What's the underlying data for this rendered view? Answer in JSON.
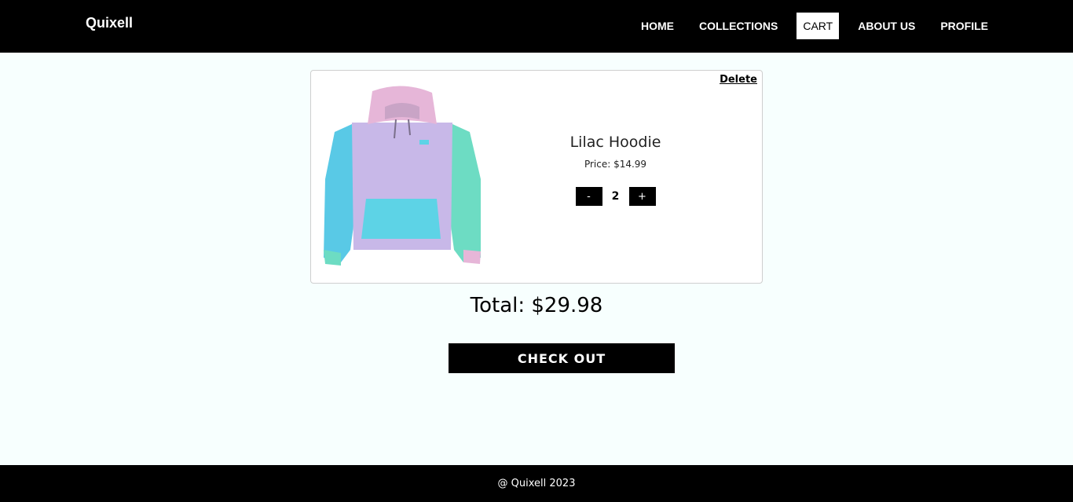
{
  "navbar": {
    "brand": "Quixell",
    "links": [
      {
        "label": "HOME"
      },
      {
        "label": "COLLECTIONS"
      },
      {
        "label": "CART"
      },
      {
        "label": "ABOUT US"
      },
      {
        "label": "PROFILE"
      }
    ],
    "active": "CART"
  },
  "cart": {
    "items": [
      {
        "delete_label": "Delete",
        "name": "Lilac Hoodie",
        "price_text": "Price: $14.99",
        "quantity": "2",
        "decrement_label": "-",
        "increment_label": "+",
        "image_icon": "hoodie-image",
        "colors": {
          "body": "#c8b8e8",
          "hood": "#e6b6d8",
          "sleeve_left": "#59c9e6",
          "sleeve_right": "#6ddcc3",
          "pocket": "#5dd3e6"
        }
      }
    ],
    "total_text": "Total: $29.98",
    "checkout_label": "CHECK OUT"
  },
  "footer": {
    "text": "@ Quixell 2023"
  },
  "colors": {
    "navbar_bg": "#000000",
    "page_bg": "#f7fffe",
    "button_bg": "#000000"
  }
}
